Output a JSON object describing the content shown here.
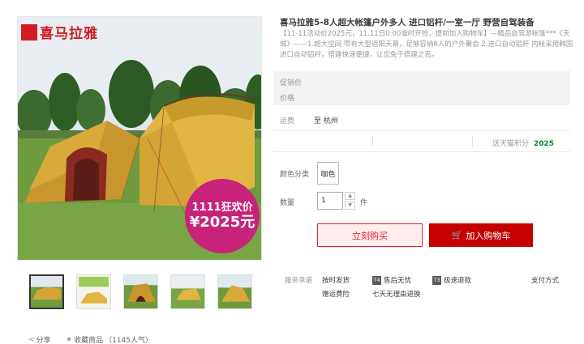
{
  "brand_logo_text": "喜马拉雅",
  "price_badge": {
    "line1": "1111狂欢价",
    "line2": "¥2025元"
  },
  "product": {
    "title": "喜马拉雅5-8人超大帐篷户外多人 进口铝杆/一室一厅 野营自驾装备",
    "subtitle": "【11-11活动价2025元，11.11日0:00准时开抢，提前加入购物车】—精品自驾游帐篷***《天城》——1.超大空间 带有大型遮阳天幕，足够容纳8人的户外聚会 2.进口自动铝杆 内帐采用韩国进口自动铝杆，搭建快速便捷，让您免于搭建之苦。"
  },
  "price": {
    "promo_label": "促销价",
    "price_label": "价格"
  },
  "shipping": {
    "label": "运费",
    "location_prefix": "至",
    "location": "杭州"
  },
  "points": {
    "label": "送天猫积分",
    "value": "2025"
  },
  "color": {
    "label": "颜色分类",
    "selected": "咖色"
  },
  "quantity": {
    "label": "数量",
    "value": "1",
    "unit": "件",
    "up": "▲",
    "down": "▼"
  },
  "buttons": {
    "buy_now": "立刻购买",
    "add_to_cart": "加入购物车"
  },
  "service": {
    "label": "服务承诺",
    "items": [
      {
        "text": "按时发货",
        "badge": ""
      },
      {
        "text": "售后无忧",
        "badge": "T4"
      },
      {
        "text": "极速退款",
        "badge": "T3"
      },
      {
        "text": "赠运费险",
        "badge": ""
      },
      {
        "text": "七天无理由退换",
        "badge": ""
      }
    ],
    "payment_label": "支付方式"
  },
  "share": {
    "label": "分享"
  },
  "favorite": {
    "label": "收藏商品",
    "count": "（1145人气）"
  },
  "icons": {
    "share": "share-icon",
    "star": "star-icon",
    "cart": "cart-icon"
  },
  "colors": {
    "accent": "#c40000",
    "price_badge": "#c7237b",
    "points": "#0a8a2a"
  }
}
